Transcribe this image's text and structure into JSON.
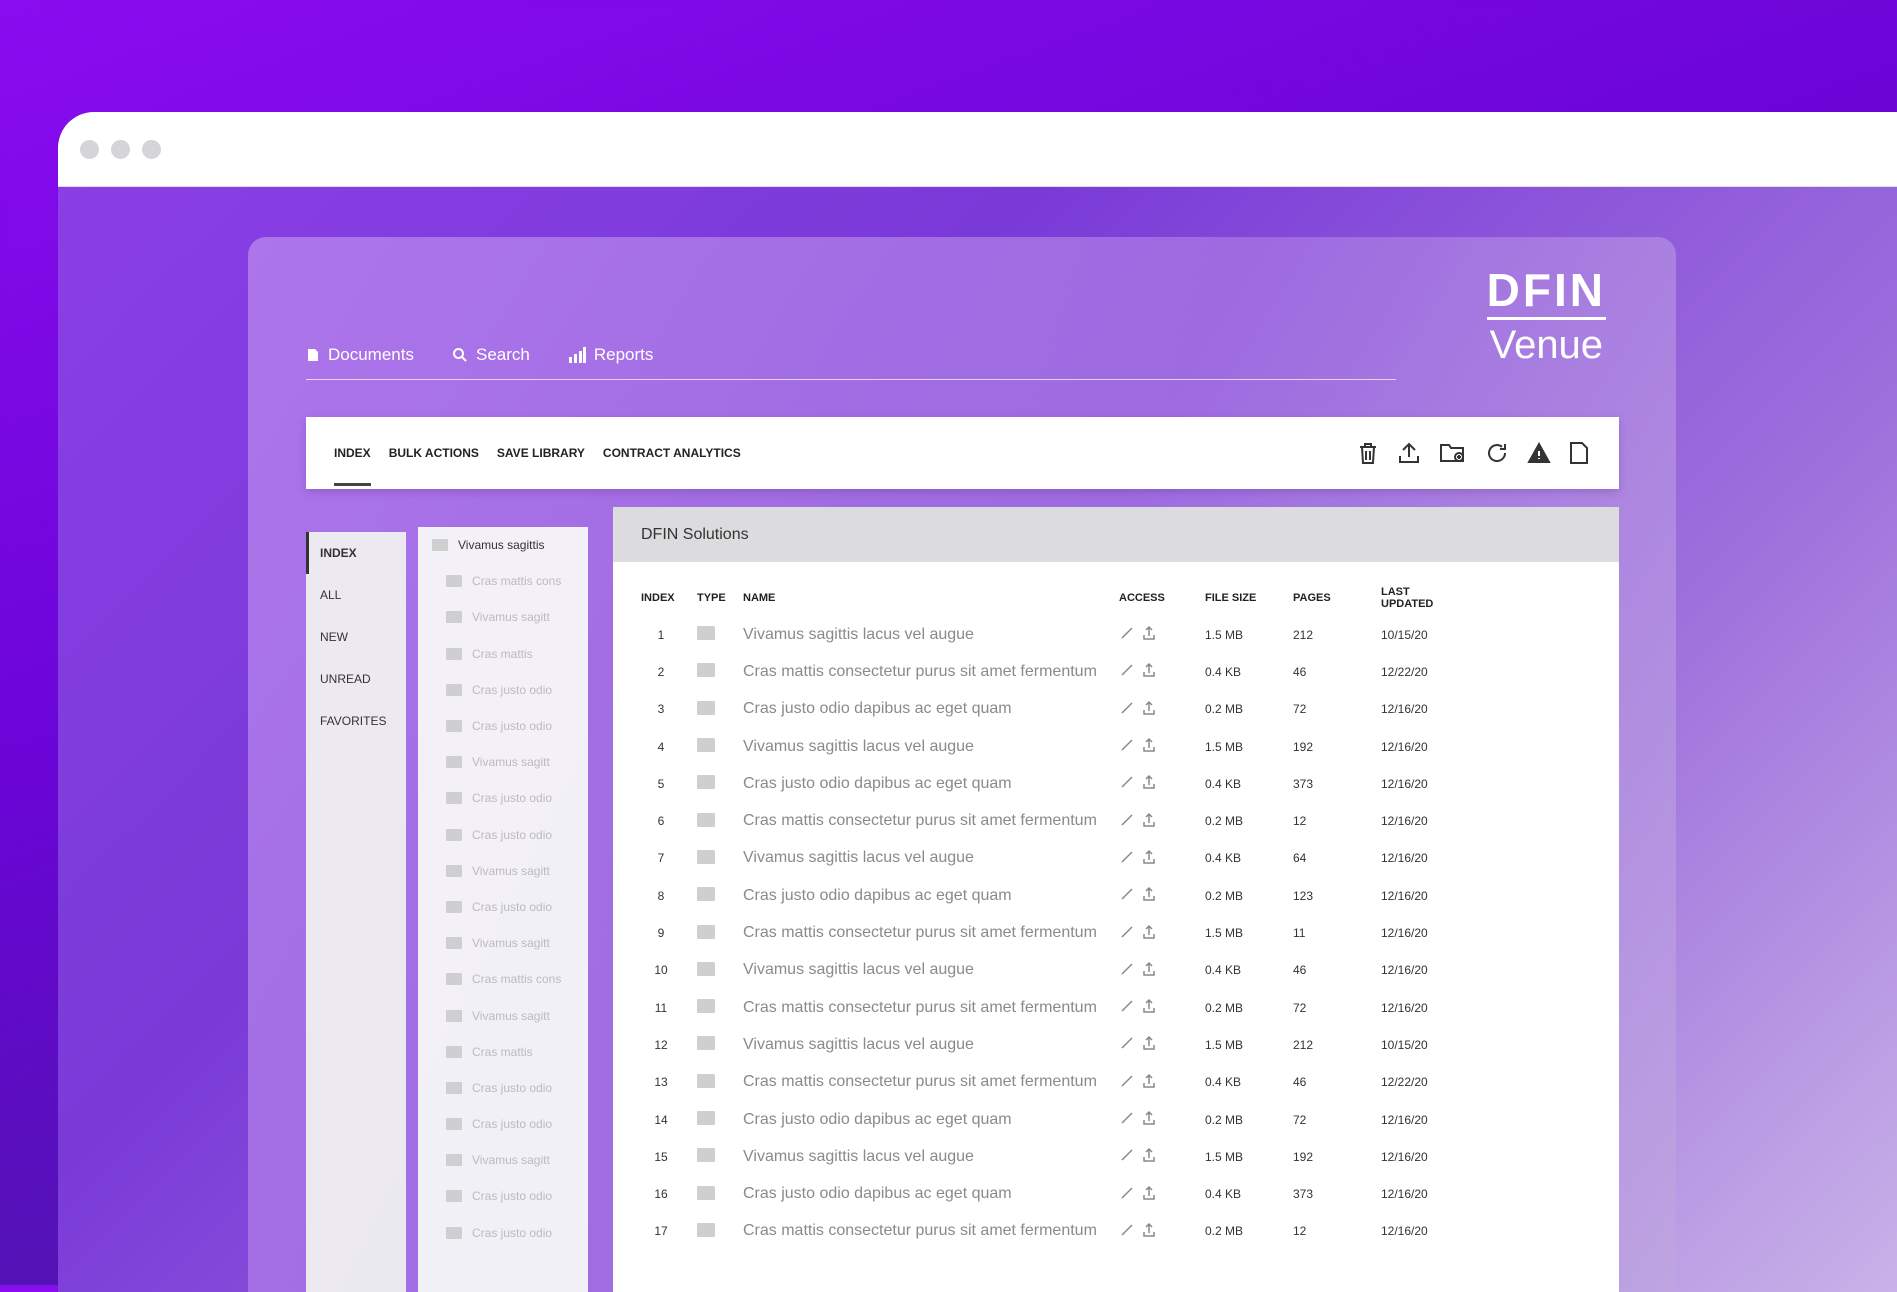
{
  "logo": {
    "brand": "DFIN",
    "product": "Venue"
  },
  "topnav": [
    {
      "label": "Documents",
      "icon": "document-icon"
    },
    {
      "label": "Search",
      "icon": "search-icon"
    },
    {
      "label": "Reports",
      "icon": "bar-chart-icon"
    }
  ],
  "tabs": [
    "INDEX",
    "BULK ACTIONS",
    "SAVE LIBRARY",
    "CONTRACT ANALYTICS"
  ],
  "toolbar_icons": [
    "trash-icon",
    "upload-icon",
    "add-folder-icon",
    "refresh-icon",
    "warning-icon",
    "file-icon"
  ],
  "filters": [
    "INDEX",
    "ALL",
    "NEW",
    "UNREAD",
    "FAVORITES"
  ],
  "tree": [
    "Vivamus sagittis",
    "Cras mattis cons",
    "Vivamus sagitt",
    "Cras mattis",
    "Cras justo odio",
    "Cras justo odio",
    "Vivamus sagitt",
    "Cras justo odio",
    "Cras justo odio",
    "Vivamus sagitt",
    "Cras justo odio",
    "Vivamus sagitt",
    "Cras mattis cons",
    "Vivamus sagitt",
    "Cras mattis",
    "Cras justo odio",
    "Cras justo odio",
    "Vivamus sagitt",
    "Cras justo odio",
    "Cras justo odio"
  ],
  "main": {
    "title": "DFIN Solutions",
    "columns": [
      "INDEX",
      "TYPE",
      "NAME",
      "ACCESS",
      "FILE SIZE",
      "PAGES",
      "LAST UPDATED"
    ],
    "rows": [
      [
        "1",
        "Vivamus sagittis lacus vel augue",
        "1.5 MB",
        "212",
        "10/15/20"
      ],
      [
        "2",
        "Cras mattis consectetur purus sit amet fermentum",
        "0.4 KB",
        "46",
        "12/22/20"
      ],
      [
        "3",
        "Cras justo odio dapibus ac eget quam",
        "0.2 MB",
        "72",
        "12/16/20"
      ],
      [
        "4",
        "Vivamus sagittis lacus vel augue",
        "1.5 MB",
        "192",
        "12/16/20"
      ],
      [
        "5",
        "Cras justo odio dapibus ac eget quam",
        "0.4 KB",
        "373",
        "12/16/20"
      ],
      [
        "6",
        "Cras mattis consectetur purus sit amet fermentum",
        "0.2 MB",
        "12",
        "12/16/20"
      ],
      [
        "7",
        "Vivamus sagittis lacus vel augue",
        "0.4 KB",
        "64",
        "12/16/20"
      ],
      [
        "8",
        "Cras justo odio dapibus ac eget quam",
        "0.2 MB",
        "123",
        "12/16/20"
      ],
      [
        "9",
        "Cras mattis consectetur purus sit amet fermentum",
        "1.5 MB",
        "11",
        "12/16/20"
      ],
      [
        "10",
        "Vivamus sagittis lacus vel augue",
        "0.4 KB",
        "46",
        "12/16/20"
      ],
      [
        "11",
        "Cras mattis consectetur purus sit amet fermentum",
        "0.2 MB",
        "72",
        "12/16/20"
      ],
      [
        "12",
        "Vivamus sagittis lacus vel augue",
        "1.5 MB",
        "212",
        "10/15/20"
      ],
      [
        "13",
        "Cras mattis consectetur purus sit amet fermentum",
        "0.4 KB",
        "46",
        "12/22/20"
      ],
      [
        "14",
        "Cras justo odio dapibus ac eget quam",
        "0.2 MB",
        "72",
        "12/16/20"
      ],
      [
        "15",
        "Vivamus sagittis lacus vel augue",
        "1.5 MB",
        "192",
        "12/16/20"
      ],
      [
        "16",
        "Cras justo odio dapibus ac eget quam",
        "0.4 KB",
        "373",
        "12/16/20"
      ],
      [
        "17",
        "Cras mattis consectetur purus sit amet fermentum",
        "0.2 MB",
        "12",
        "12/16/20"
      ]
    ]
  }
}
